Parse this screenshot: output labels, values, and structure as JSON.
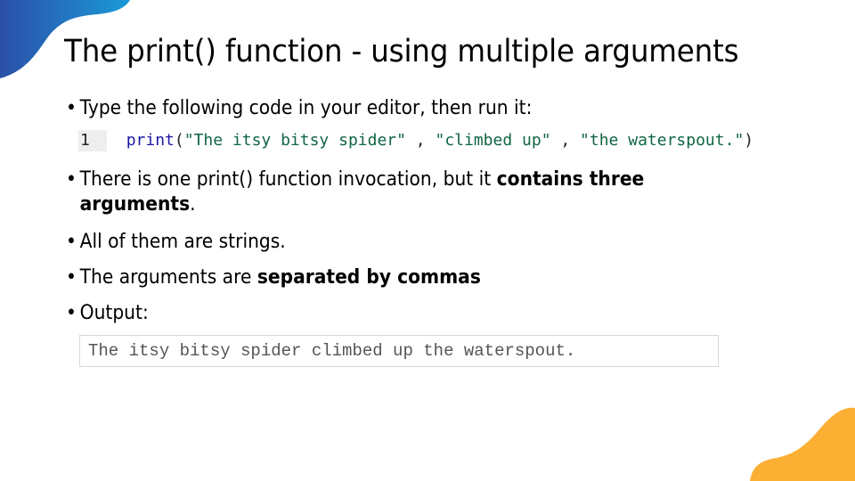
{
  "slide": {
    "title": "The print() function - using multiple arguments",
    "bullets": [
      {
        "segments": [
          {
            "text": "Type the following code in your editor, then run it:",
            "bold": false
          }
        ]
      },
      {
        "segments": [
          {
            "text": "There is one print() function invocation, but it ",
            "bold": false
          },
          {
            "text": "contains three",
            "bold": true
          }
        ],
        "continuation": {
          "text": "arguments",
          "bold": true,
          "suffix": "."
        }
      },
      {
        "segments": [
          {
            "text": "All of them are strings.",
            "bold": false
          }
        ]
      },
      {
        "segments": [
          {
            "text": "The arguments are ",
            "bold": false
          },
          {
            "text": "separated by commas",
            "bold": true
          }
        ]
      },
      {
        "segments": [
          {
            "text": "Output:",
            "bold": false
          }
        ]
      }
    ],
    "bullet_glyph": "•",
    "code": {
      "line_number": "1",
      "function": "print",
      "open_paren": "(",
      "args": [
        "\"The itsy bitsy spider\"",
        "\"climbed up\"",
        "\"the waterspout.\""
      ],
      "separator": " , ",
      "close_paren": ")"
    },
    "output": "The itsy bitsy spider climbed up the waterspout.",
    "colors": {
      "accent_blue_start": "#2b4fa8",
      "accent_blue_end": "#1a9ad8",
      "accent_orange": "#fbb034",
      "code_function": "#1a1aa6",
      "code_string": "#116644"
    },
    "decorations": [
      "blue-wave-top-left",
      "orange-wave-bottom-right"
    ]
  }
}
